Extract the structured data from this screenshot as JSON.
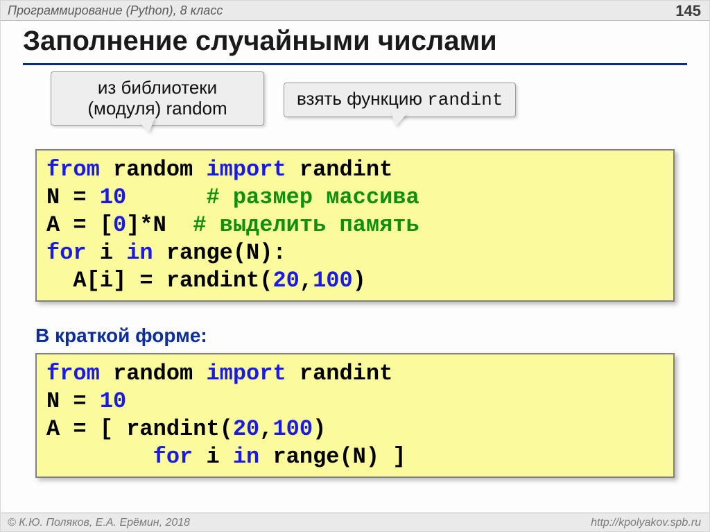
{
  "header": {
    "course": "Программирование (Python), 8 класс",
    "page": "145"
  },
  "title": "Заполнение случайными числами",
  "callouts": {
    "lib": {
      "line1": "из библиотеки",
      "line2": "(модуля) random"
    },
    "func": {
      "text": "взять функцию ",
      "code": "randint"
    }
  },
  "code1": {
    "l1": {
      "a": "from",
      "b": "random",
      "c": "import",
      "d": "randint"
    },
    "l2": {
      "a": "N = ",
      "b": "10",
      "pad": "      ",
      "c": "# размер массива"
    },
    "l3": {
      "a": "A = [",
      "b": "0",
      "c": "]*N",
      "pad": "  ",
      "d": "# выделить память"
    },
    "l4": {
      "a": "for",
      "b": "i",
      "c": "in",
      "d": "range(N):"
    },
    "l5": {
      "pad": "  ",
      "a": "A[i] = ",
      "b": "randint(",
      "c": "20",
      "d": ",",
      "e": "100",
      "f": ")"
    }
  },
  "subhead": "В краткой форме:",
  "code2": {
    "l1": {
      "a": "from",
      "b": "random",
      "c": "import",
      "d": "randint"
    },
    "l2": {
      "a": "N = ",
      "b": "10"
    },
    "l3": {
      "a": "A = [ ",
      "b": "randint(",
      "c": "20",
      "d": ",",
      "e": "100",
      "f": ")"
    },
    "l4": {
      "pad": "        ",
      "a": "for",
      "b": "i",
      "c": "in",
      "d": "range(N) ]"
    }
  },
  "footer": {
    "left": "© К.Ю. Поляков, Е.А. Ерёмин, 2018",
    "right": "http://kpolyakov.spb.ru"
  }
}
